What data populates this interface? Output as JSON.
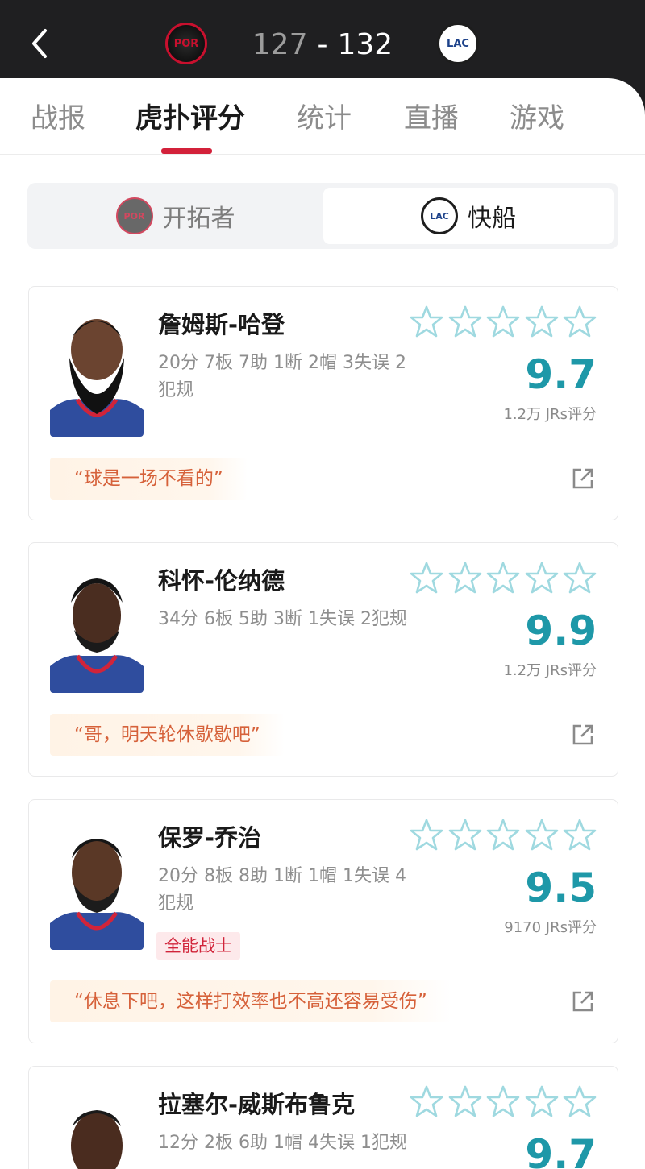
{
  "header": {
    "away_score": "127",
    "separator": "-",
    "home_score": "132",
    "away_logo_text": "POR",
    "home_logo_text": "LAC"
  },
  "tabs": [
    {
      "label": "战报",
      "active": false
    },
    {
      "label": "虎扑评分",
      "active": true
    },
    {
      "label": "统计",
      "active": false
    },
    {
      "label": "直播",
      "active": false
    },
    {
      "label": "游戏",
      "active": false
    }
  ],
  "team_switch": {
    "left": {
      "label": "开拓者",
      "logo_text": "POR",
      "selected": false
    },
    "right": {
      "label": "快船",
      "logo_text": "LAC",
      "selected": true
    }
  },
  "players": [
    {
      "name": "詹姆斯-哈登",
      "stats": "20分 7板 7助 1断 2帽 3失误 2犯规",
      "rating": "9.7",
      "votes": "1.2万 JRs评分",
      "quote": "“球是一场不看的”",
      "badge": ""
    },
    {
      "name": "科怀-伦纳德",
      "stats": "34分 6板 5助 3断 1失误 2犯规",
      "rating": "9.9",
      "votes": "1.2万 JRs评分",
      "quote": "“哥，明天轮休歇歇吧”",
      "badge": ""
    },
    {
      "name": "保罗-乔治",
      "stats": "20分 8板 8助 1断 1帽 1失误 4犯规",
      "rating": "9.5",
      "votes": "9170 JRs评分",
      "quote": "“休息下吧，这样打效率也不高还容易受伤”",
      "badge": "全能战士"
    },
    {
      "name": "拉塞尔-威斯布鲁克",
      "stats": "12分 2板 6助 1帽 4失误 1犯规",
      "rating": "9.7",
      "votes": "",
      "quote": "",
      "badge": ""
    }
  ],
  "colors": {
    "accent_red": "#d3213a",
    "rating_teal": "#1e98a8",
    "star_outline": "#9fd9e0",
    "quote_text": "#d6613a"
  },
  "icons": {
    "back": "chevron-left-icon",
    "star": "star-outline-icon",
    "share": "share-external-icon"
  }
}
